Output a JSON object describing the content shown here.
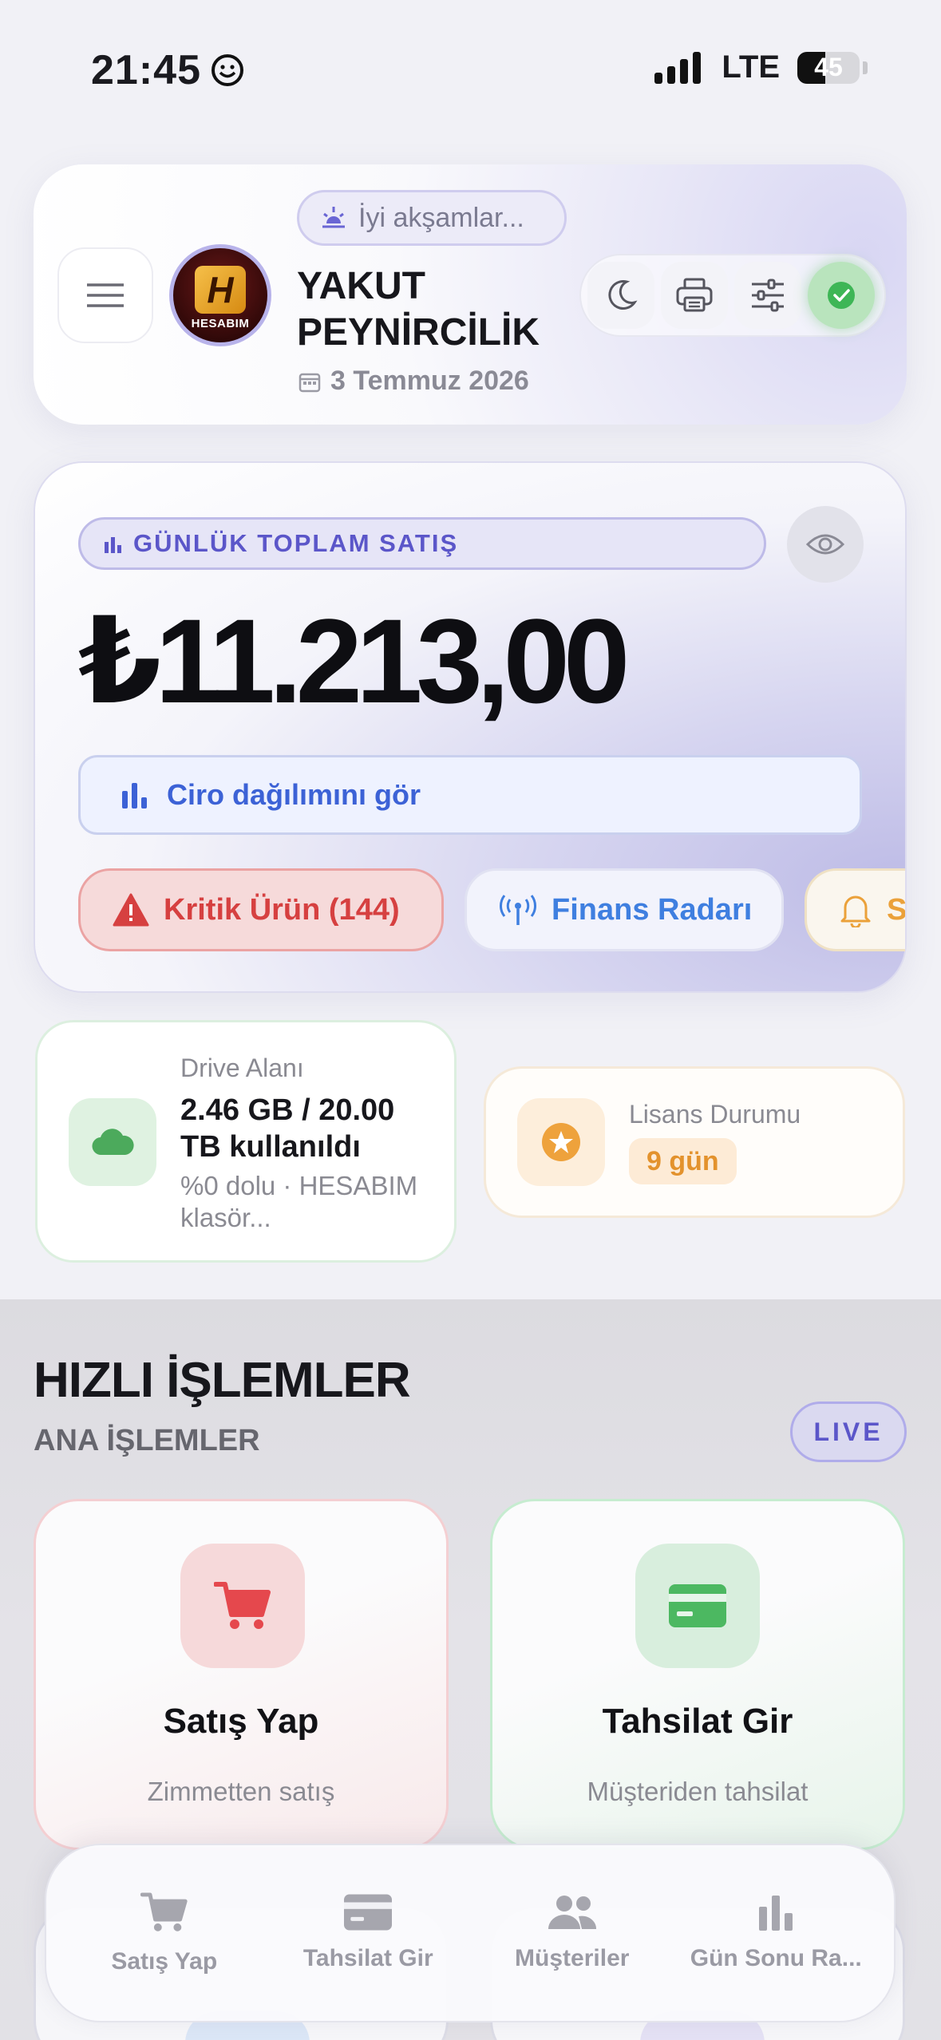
{
  "status_bar": {
    "time": "21:45",
    "network": "LTE",
    "battery": "45",
    "battery_level": 0.45
  },
  "header": {
    "greeting": "İyi akşamlar...",
    "logo_text": "HESABIM",
    "logo_letter": "H",
    "company_line1": "YAKUT",
    "company_line2": "PEYNİRCİLİK",
    "date": "3 Temmuz 2026",
    "tools": [
      "moon-icon",
      "printer-icon",
      "sliders-icon",
      "check-circle-icon"
    ]
  },
  "sales": {
    "label": "GÜNLÜK TOPLAM SATIŞ",
    "amount": "₺11.213,00",
    "ciro_button": "Ciro dağılımını gör",
    "chips": [
      {
        "label": "Kritik Ürün (144)",
        "icon": "warning-icon",
        "color": "#d64040"
      },
      {
        "label": "Finans Radarı",
        "icon": "radar-icon",
        "color": "#3f7fe0"
      },
      {
        "label": "S",
        "icon": "bell-icon",
        "color": "#eba13a"
      }
    ]
  },
  "drive": {
    "title": "Drive Alanı",
    "usage": "2.46 GB / 20.00 TB kullanıldı",
    "detail": "%0 dolu · HESABIM klasör..."
  },
  "license": {
    "title": "Lisans Durumu",
    "days": "9 gün"
  },
  "quick_actions": {
    "title": "HIZLI İŞLEMLER",
    "subtitle": "ANA İŞLEMLER",
    "live_badge": "LIVE",
    "cards": [
      {
        "label": "Satış Yap",
        "subtitle": "Zimmetten satış",
        "icon": "cart-icon",
        "color": "#e5484d"
      },
      {
        "label": "Tahsilat Gir",
        "subtitle": "Müşteriden tahsilat",
        "icon": "card-icon",
        "color": "#4cb861"
      }
    ]
  },
  "bottom_nav": [
    {
      "label": "Satış Yap",
      "icon": "cart-icon"
    },
    {
      "label": "Tahsilat Gir",
      "icon": "card-icon"
    },
    {
      "label": "Müşteriler",
      "icon": "users-icon"
    },
    {
      "label": "Gün Sonu Ra...",
      "icon": "bar-chart-icon"
    }
  ]
}
